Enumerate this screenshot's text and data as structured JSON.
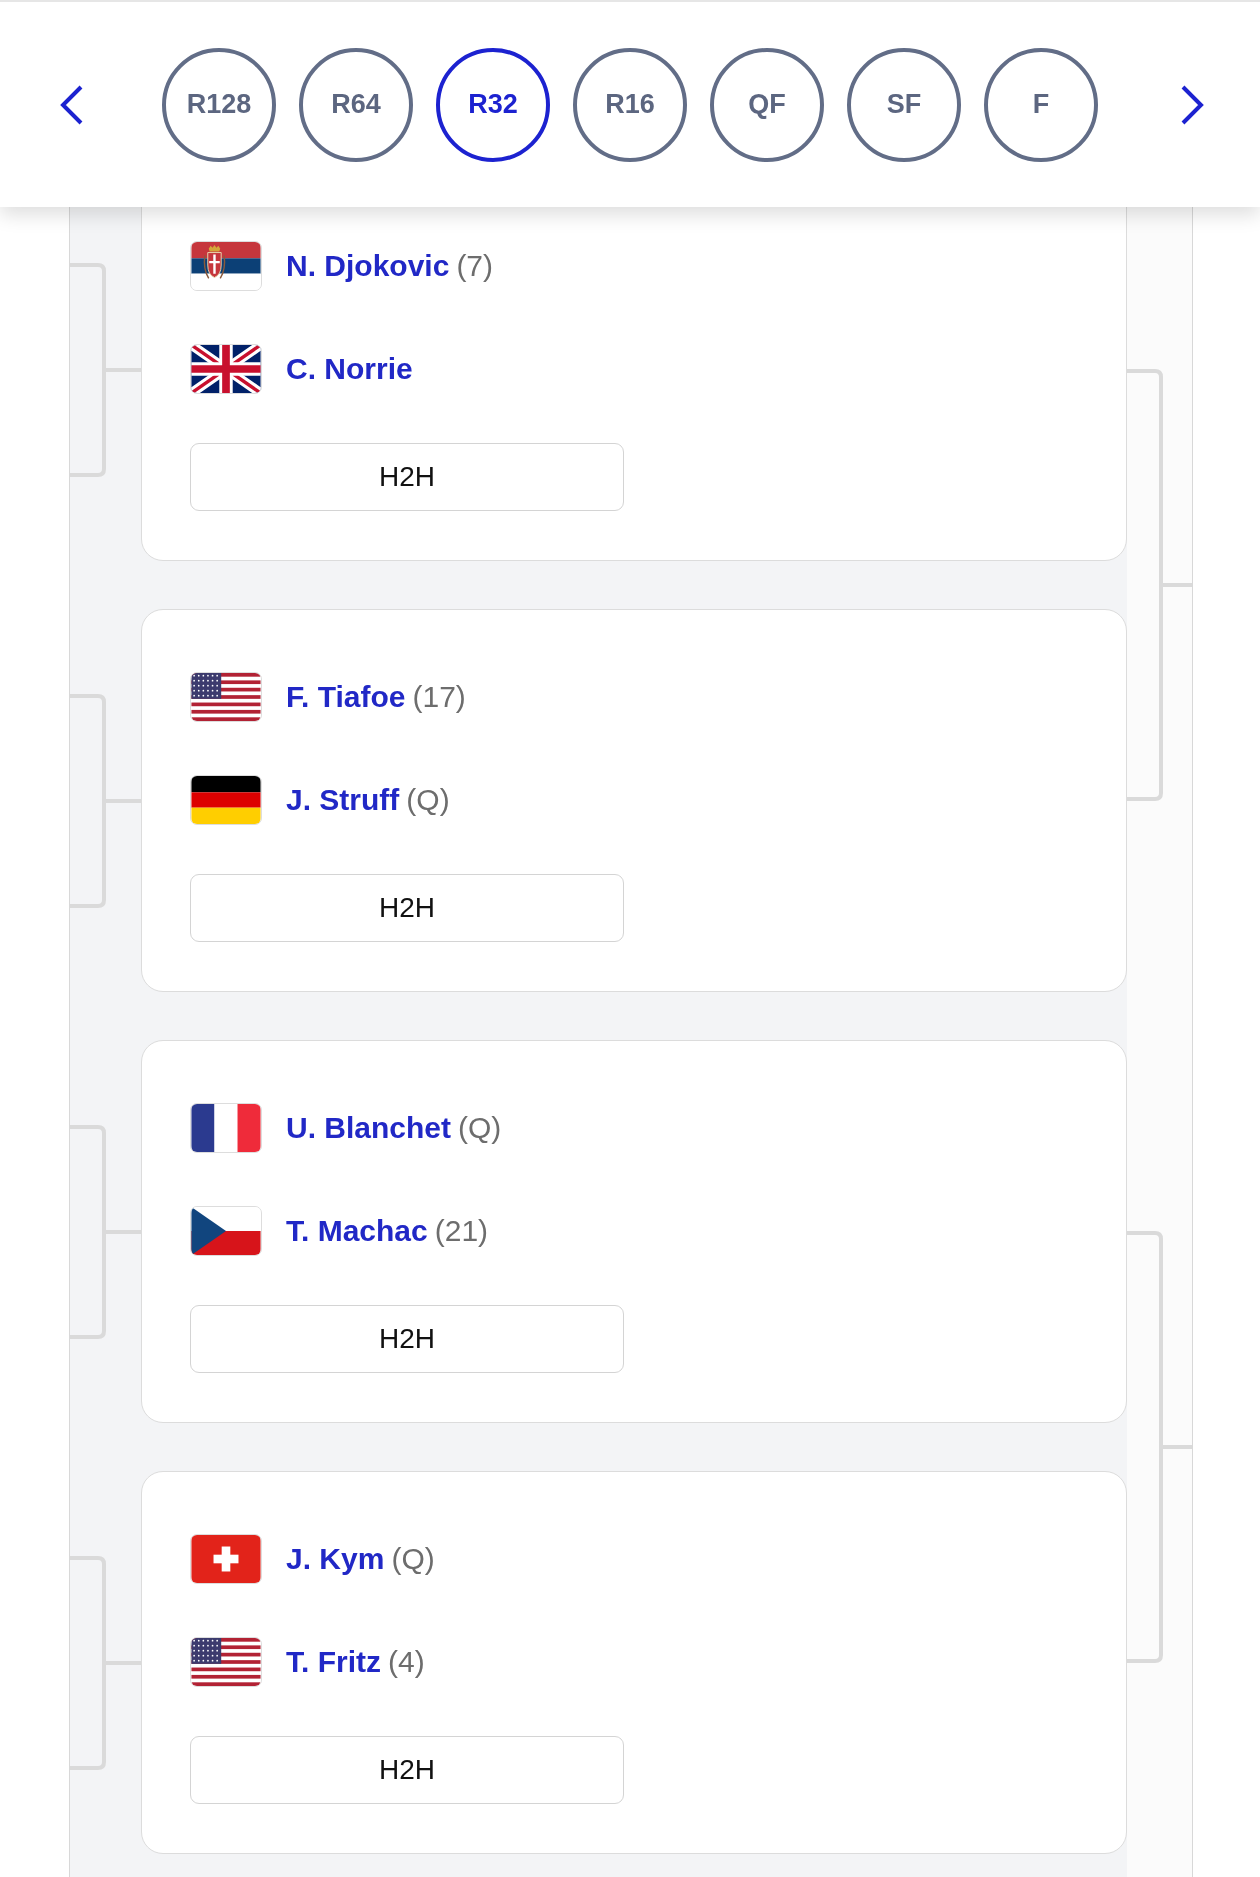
{
  "round_nav": {
    "rounds": [
      {
        "label": "R128",
        "selected": false
      },
      {
        "label": "R64",
        "selected": false
      },
      {
        "label": "R32",
        "selected": true
      },
      {
        "label": "R16",
        "selected": false
      },
      {
        "label": "QF",
        "selected": false
      },
      {
        "label": "SF",
        "selected": false
      },
      {
        "label": "F",
        "selected": false
      }
    ]
  },
  "matches": [
    {
      "players": [
        {
          "flag": {
            "kind": "serbia"
          },
          "name": "N. Djokovic",
          "seed": "(7)"
        },
        {
          "flag": {
            "kind": "uk"
          },
          "name": "C. Norrie"
        }
      ],
      "h2h_button": "H2H"
    },
    {
      "players": [
        {
          "flag": {
            "kind": "usa"
          },
          "name": "F. Tiafoe",
          "seed": "(17)"
        },
        {
          "flag": {
            "kind": "germany"
          },
          "name": "J. Struff",
          "seed": "(Q)"
        }
      ],
      "h2h_button": "H2H"
    },
    {
      "players": [
        {
          "flag": {
            "kind": "france"
          },
          "name": "U. Blanchet",
          "seed": "(Q)"
        },
        {
          "flag": {
            "kind": "czech"
          },
          "name": "T. Machac",
          "seed": "(21)"
        }
      ],
      "h2h_button": "H2H"
    },
    {
      "players": [
        {
          "flag": {
            "kind": "switzerland"
          },
          "name": "J. Kym",
          "seed": "(Q)"
        },
        {
          "flag": {
            "kind": "usa"
          },
          "name": "T. Fritz",
          "seed": "(4)"
        }
      ],
      "h2h_button": "H2H"
    }
  ]
}
